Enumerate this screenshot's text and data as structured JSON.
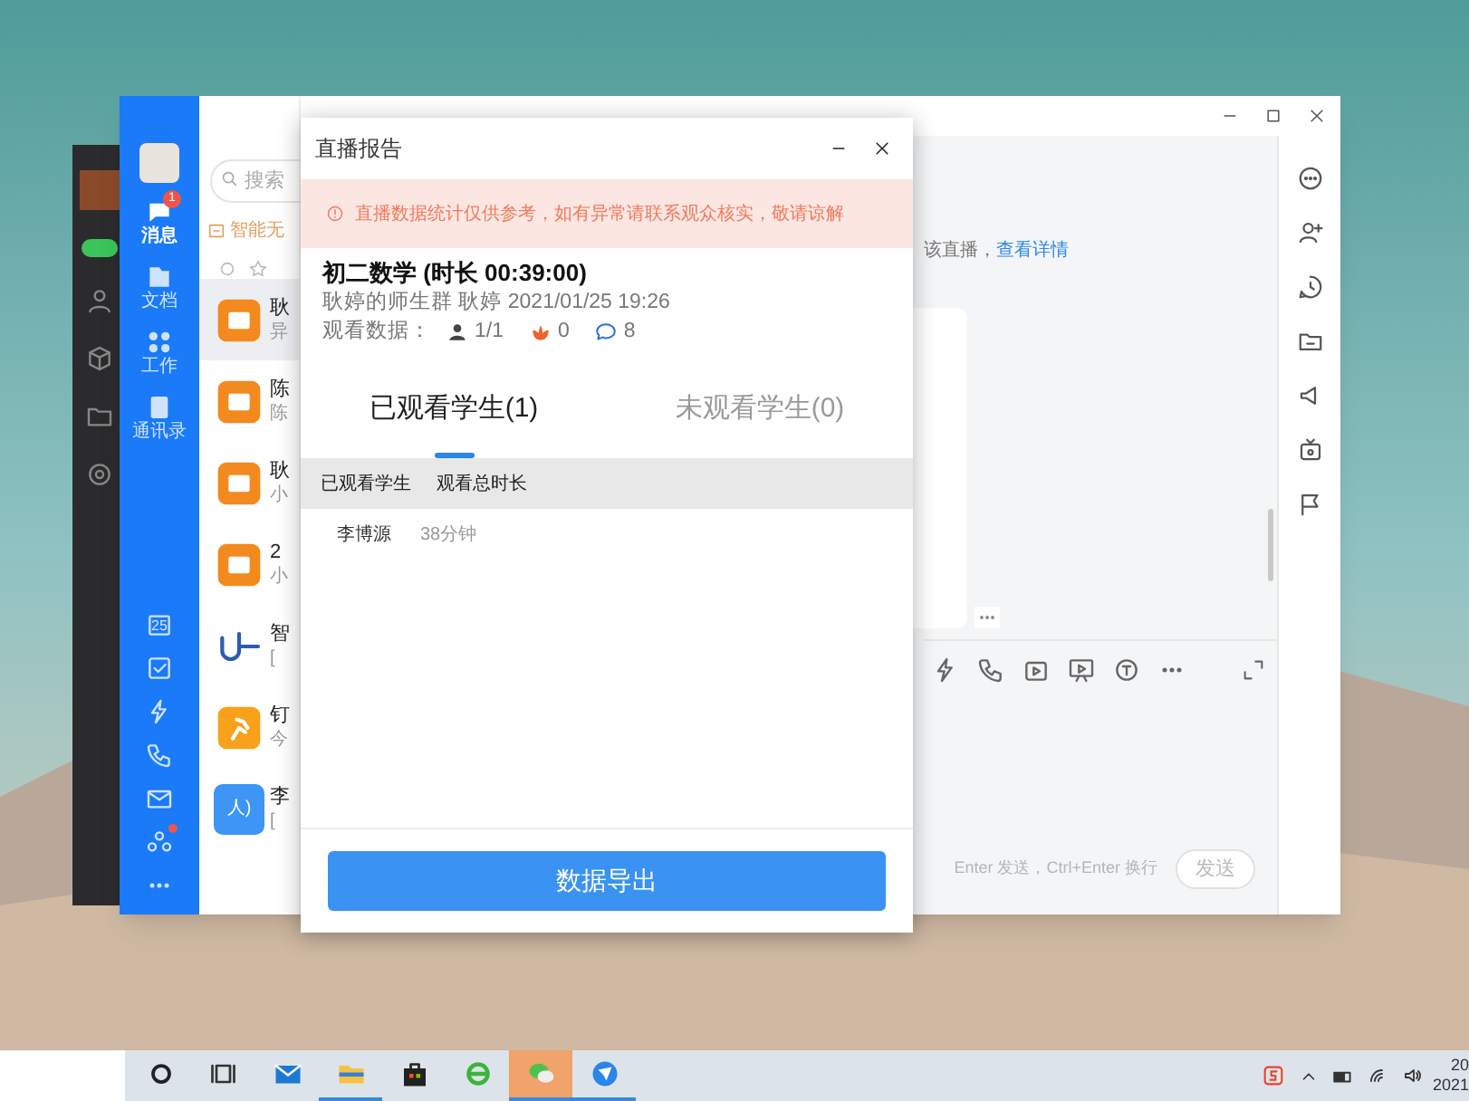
{
  "main_window": {
    "nav": {
      "items": [
        {
          "label": "消息",
          "badge": "1",
          "selected": true
        },
        {
          "label": "文档",
          "selected": false
        },
        {
          "label": "工作",
          "selected": false
        },
        {
          "label": "通讯录",
          "selected": false
        }
      ],
      "tools": [
        {
          "kind": "calendar",
          "text": "25",
          "dot": false
        },
        {
          "kind": "todo",
          "dot": false
        },
        {
          "kind": "ding",
          "dot": false
        },
        {
          "kind": "call",
          "dot": false
        },
        {
          "kind": "mail",
          "dot": false
        },
        {
          "kind": "apps",
          "dot": true
        },
        {
          "kind": "more",
          "dot": false
        }
      ]
    },
    "search": {
      "placeholder": "搜索"
    },
    "notice": "智能无",
    "conversations": [
      {
        "title": "耿",
        "preview": "异",
        "kind": "book",
        "selected": true
      },
      {
        "title": "陈",
        "preview": "陈",
        "kind": "book",
        "selected": false
      },
      {
        "title": "耿",
        "preview": "小",
        "kind": "book",
        "selected": false
      },
      {
        "title": "2",
        "preview": "小",
        "kind": "book",
        "selected": false
      },
      {
        "title": "智",
        "preview": "[",
        "kind": "logo",
        "selected": false
      },
      {
        "title": "钉",
        "preview": "今",
        "kind": "runner",
        "selected": false
      },
      {
        "title": "李",
        "preview": "[",
        "kind": "person",
        "avatar_text": "人)",
        "selected": false
      }
    ],
    "chat": {
      "notice": "该直播，",
      "link": "查看详情",
      "hint": "Enter 发送，Ctrl+Enter 换行",
      "send": "发送"
    }
  },
  "dialog": {
    "title": "直播报告",
    "warning": "直播数据统计仅供参考，如有异常请联系观众核实，敬请谅解",
    "lesson": {
      "title": "初二数学 (时长 00:39:00)",
      "meta": "耿婷的师生群 耿婷 2021/01/25 19:26",
      "stats_label": "观看数据：",
      "stats": [
        {
          "kind": "viewers",
          "value": "1/1"
        },
        {
          "kind": "likes",
          "value": "0"
        },
        {
          "kind": "comments",
          "value": "8"
        }
      ]
    },
    "tabs": [
      {
        "label": "已观看学生(1)",
        "selected": true
      },
      {
        "label": "未观看学生(0)",
        "selected": false
      }
    ],
    "table": {
      "columns": [
        "已观看学生",
        "观看总时长"
      ],
      "rows": [
        [
          "李博源",
          "38分钟"
        ]
      ]
    },
    "export_button": "数据导出"
  },
  "taskbar": {
    "apps": [
      {
        "kind": "cortana",
        "running": false,
        "highlighted": false
      },
      {
        "kind": "taskview",
        "running": false,
        "highlighted": false
      },
      {
        "kind": "mail",
        "running": false,
        "highlighted": false
      },
      {
        "kind": "folder",
        "running": true,
        "highlighted": false
      },
      {
        "kind": "store",
        "running": false,
        "highlighted": false
      },
      {
        "kind": "ie",
        "running": false,
        "highlighted": false
      },
      {
        "kind": "wechat",
        "running": true,
        "highlighted": true
      },
      {
        "kind": "dingtalk",
        "running": true,
        "highlighted": false
      }
    ],
    "clock": [
      "20",
      "2021"
    ]
  }
}
